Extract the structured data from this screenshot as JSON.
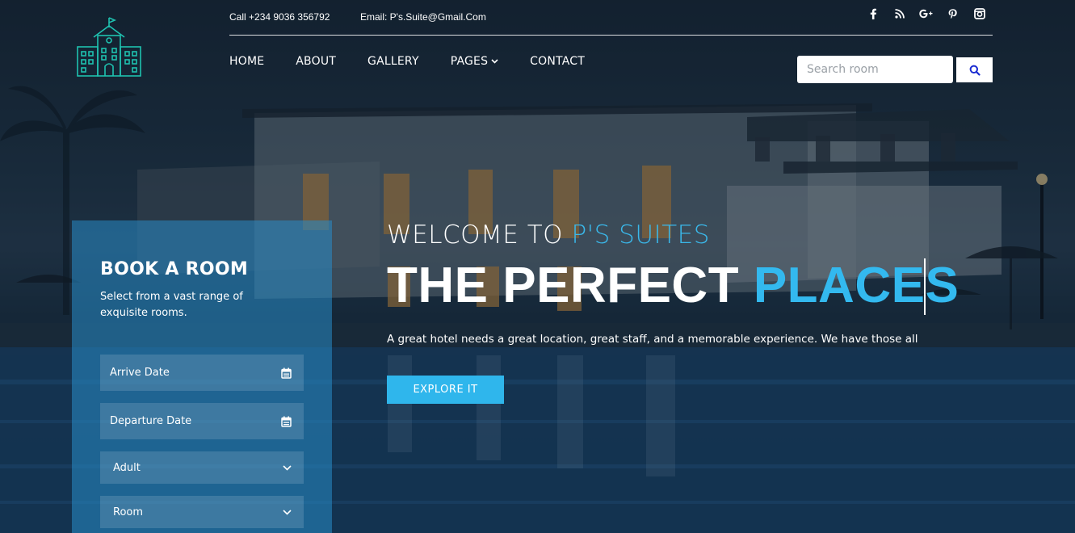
{
  "header": {
    "phone": "Call +234 9036 356792",
    "email": "Email: P's.Suite@Gmail.Com",
    "social": [
      "facebook-icon",
      "rss-icon",
      "google-plus-icon",
      "pinterest-icon",
      "instagram-icon"
    ]
  },
  "nav": {
    "items": [
      {
        "label": "HOME"
      },
      {
        "label": "ABOUT"
      },
      {
        "label": "GALLERY"
      },
      {
        "label": "PAGES",
        "has_dropdown": true
      },
      {
        "label": "CONTACT"
      }
    ]
  },
  "search": {
    "placeholder": "Search room",
    "value": ""
  },
  "booking": {
    "title": "BOOK A ROOM",
    "subtitle": "Select from a vast range of exquisite rooms.",
    "arrive_placeholder": "Arrive Date",
    "departure_placeholder": "Departure Date",
    "adult_selected": "Adult",
    "room_selected": "Room"
  },
  "hero": {
    "welcome_prefix": "WELCOME TO ",
    "welcome_brand": "P'S SUITES",
    "headline_main": "THE PERFECT ",
    "headline_accent": "PLACES",
    "tagline": "A great hotel needs a great location, great staff, and a memorable experience. We have those all",
    "cta_label": "EXPLORE IT"
  },
  "colors": {
    "accent": "#33b9ef",
    "panel": "#288cc8",
    "logo": "#1fc2b0"
  }
}
